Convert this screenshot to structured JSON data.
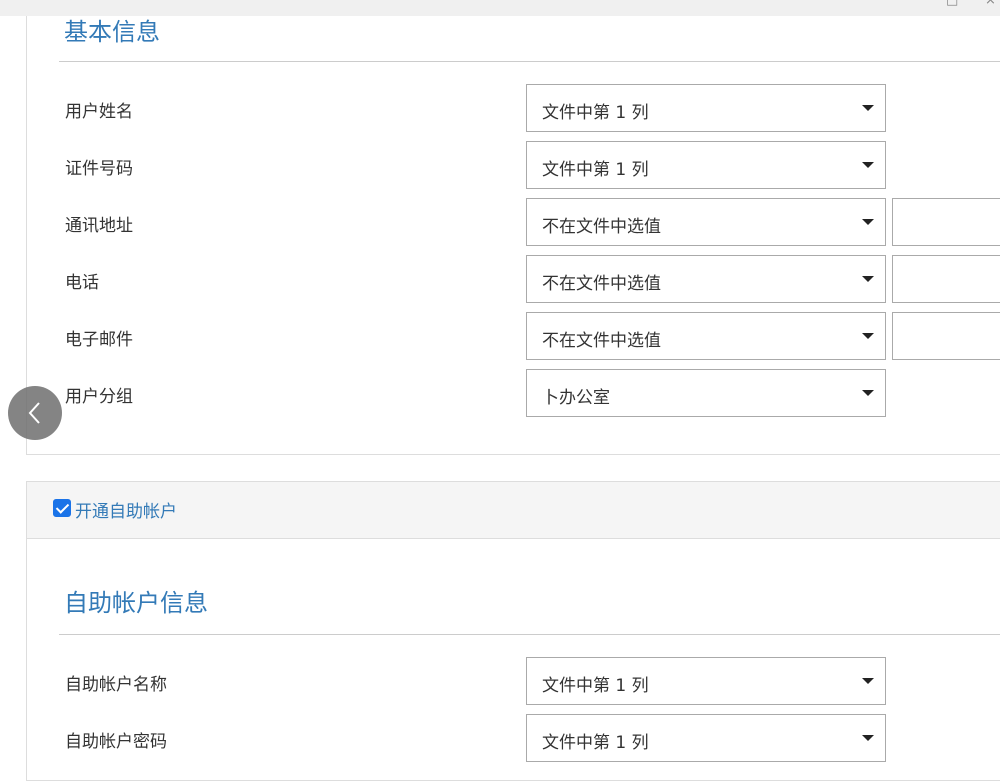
{
  "window": {
    "restore_glyph": "□",
    "close_glyph": "×"
  },
  "basic_info": {
    "title": "基本信息",
    "rows": [
      {
        "label": "用户姓名",
        "value": "文件中第 1 列",
        "side_input": false
      },
      {
        "label": "证件号码",
        "value": "文件中第 1 列",
        "side_input": false
      },
      {
        "label": "通讯地址",
        "value": "不在文件中选值",
        "side_input": true
      },
      {
        "label": "电话",
        "value": "不在文件中选值",
        "side_input": true
      },
      {
        "label": "电子邮件",
        "value": "不在文件中选值",
        "side_input": true
      },
      {
        "label": "用户分组",
        "value": "卜办公室",
        "side_input": false
      }
    ]
  },
  "self_service": {
    "checkbox_label": "开通自助帐户",
    "checked": true,
    "title": "自助帐户信息",
    "rows": [
      {
        "label": "自助帐户名称",
        "value": "文件中第 1 列"
      },
      {
        "label": "自助帐户密码",
        "value": "文件中第 1 列"
      }
    ]
  },
  "icons": {
    "back": "chevron-left-icon",
    "dropdown": "caret-down-icon"
  },
  "colors": {
    "accent": "#337ab7",
    "checkbox": "#1a73e8",
    "border": "#aaaaaa"
  }
}
